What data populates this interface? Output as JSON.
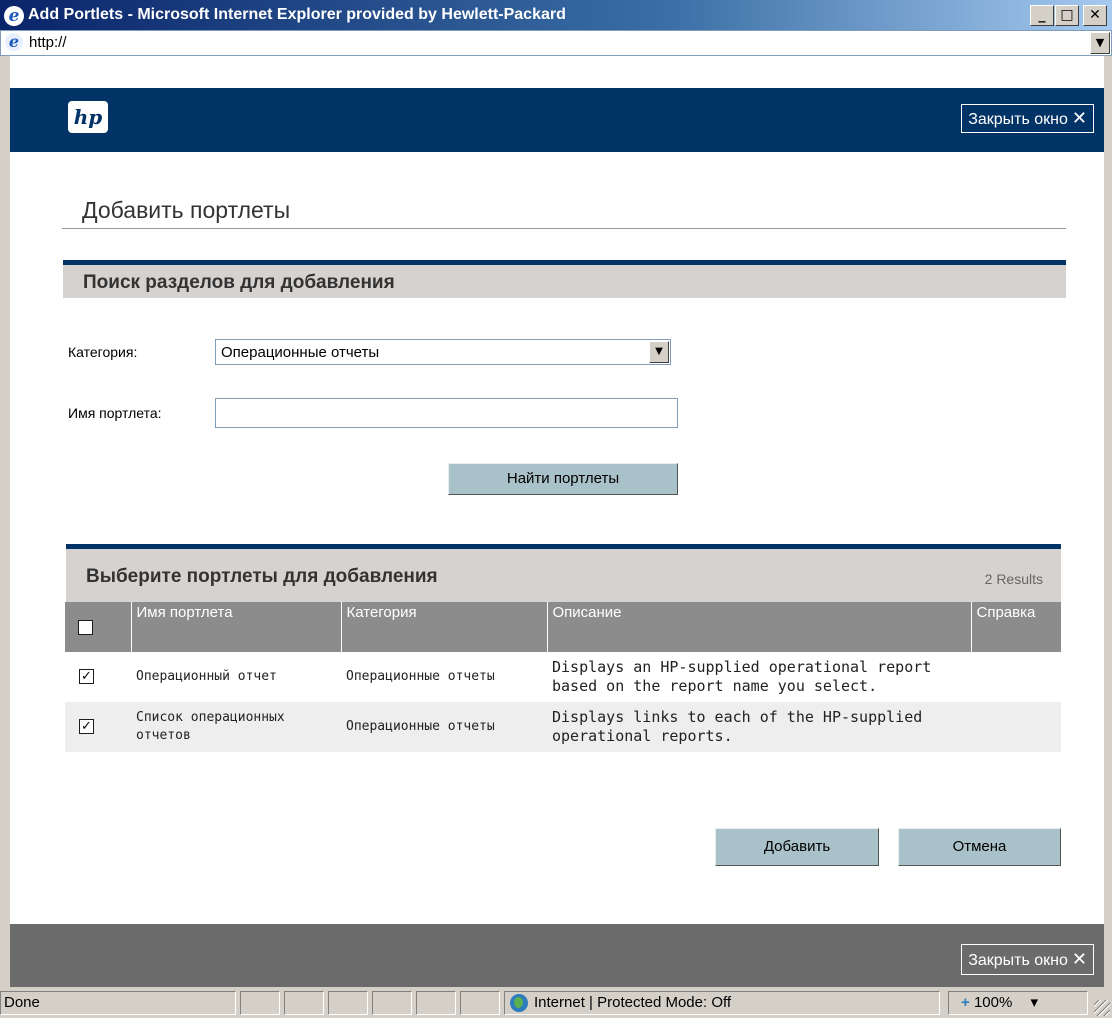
{
  "window": {
    "title": "Add Portlets - Microsoft Internet Explorer provided by Hewlett-Packard",
    "minimize_glyph": "_",
    "maximize_glyph": "□",
    "close_glyph": "✕"
  },
  "address_bar": {
    "url": "http://"
  },
  "header": {
    "logo_text": "hp",
    "close_label": "Закрыть окно",
    "close_glyph": "✕"
  },
  "page": {
    "title": "Добавить портлеты"
  },
  "search": {
    "section_title": "Поиск разделов для добавления",
    "category_label": "Категория:",
    "category_value": "Операционные отчеты",
    "name_label": "Имя портлета:",
    "name_value": "",
    "find_button": "Найти портлеты"
  },
  "results": {
    "section_title": "Выберите портлеты для добавления",
    "count": "2 Results",
    "columns": [
      "Имя портлета",
      "Категория",
      "Описание",
      "Справка"
    ],
    "rows": [
      {
        "checked": true,
        "name": "Операционный отчет",
        "category": "Операционные отчеты",
        "description": "Displays an HP-supplied operational report based on the report name you select.",
        "help": ""
      },
      {
        "checked": true,
        "name": "Список операционных отчетов",
        "category": "Операционные отчеты",
        "description": "Displays links to each of the HP-supplied operational reports.",
        "help": ""
      }
    ]
  },
  "actions": {
    "add_button": "Добавить",
    "cancel_button": "Отмена"
  },
  "footer": {
    "close_label": "Закрыть окно",
    "close_glyph": "✕"
  },
  "statusbar": {
    "status": "Done",
    "zone": "Internet | Protected Mode: Off",
    "zoom": "100%",
    "zoom_icon": "+",
    "zoom_drop": "▾"
  },
  "colors": {
    "header_bg": "#023366",
    "section_bar_bg": "#d6d2cf",
    "table_header_bg": "#8c8c8c",
    "button_bg": "#a9c1c8",
    "footer_bg": "#6b6b6b"
  }
}
